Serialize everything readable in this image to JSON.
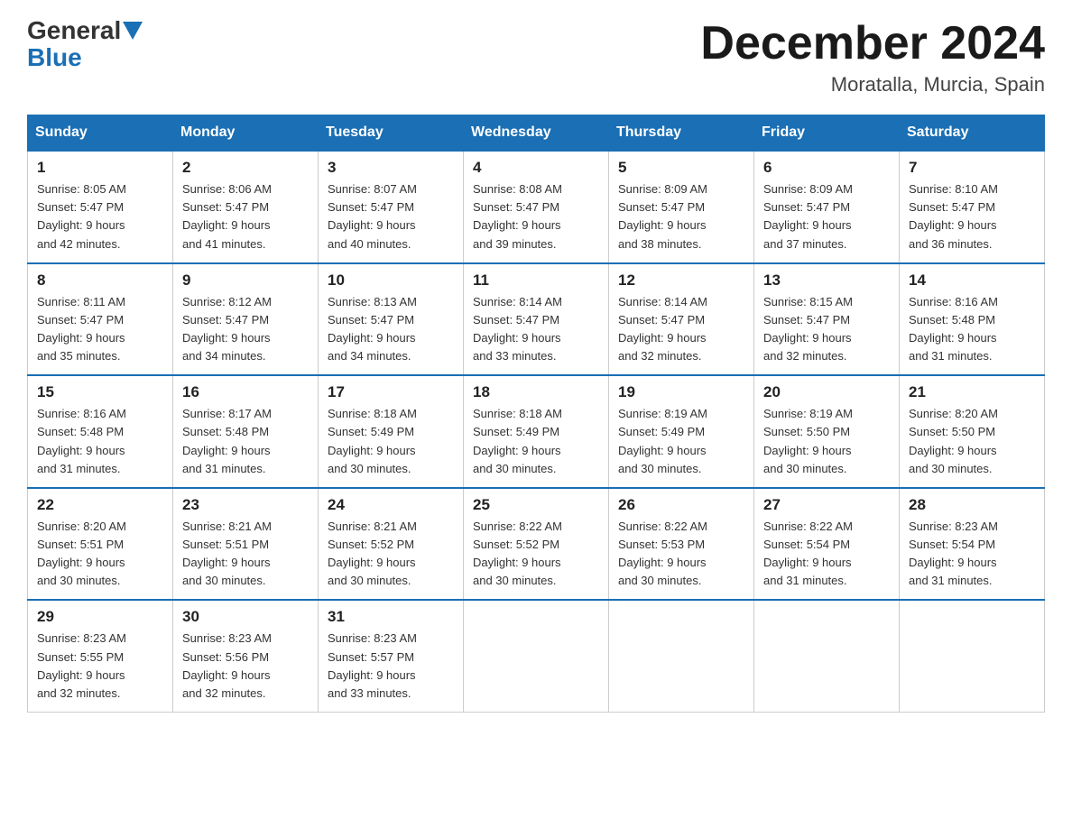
{
  "header": {
    "logo_general": "General",
    "logo_blue": "Blue",
    "month_year": "December 2024",
    "location": "Moratalla, Murcia, Spain"
  },
  "weekdays": [
    "Sunday",
    "Monday",
    "Tuesday",
    "Wednesday",
    "Thursday",
    "Friday",
    "Saturday"
  ],
  "weeks": [
    [
      {
        "day": "1",
        "sunrise": "8:05 AM",
        "sunset": "5:47 PM",
        "daylight": "9 hours and 42 minutes."
      },
      {
        "day": "2",
        "sunrise": "8:06 AM",
        "sunset": "5:47 PM",
        "daylight": "9 hours and 41 minutes."
      },
      {
        "day": "3",
        "sunrise": "8:07 AM",
        "sunset": "5:47 PM",
        "daylight": "9 hours and 40 minutes."
      },
      {
        "day": "4",
        "sunrise": "8:08 AM",
        "sunset": "5:47 PM",
        "daylight": "9 hours and 39 minutes."
      },
      {
        "day": "5",
        "sunrise": "8:09 AM",
        "sunset": "5:47 PM",
        "daylight": "9 hours and 38 minutes."
      },
      {
        "day": "6",
        "sunrise": "8:09 AM",
        "sunset": "5:47 PM",
        "daylight": "9 hours and 37 minutes."
      },
      {
        "day": "7",
        "sunrise": "8:10 AM",
        "sunset": "5:47 PM",
        "daylight": "9 hours and 36 minutes."
      }
    ],
    [
      {
        "day": "8",
        "sunrise": "8:11 AM",
        "sunset": "5:47 PM",
        "daylight": "9 hours and 35 minutes."
      },
      {
        "day": "9",
        "sunrise": "8:12 AM",
        "sunset": "5:47 PM",
        "daylight": "9 hours and 34 minutes."
      },
      {
        "day": "10",
        "sunrise": "8:13 AM",
        "sunset": "5:47 PM",
        "daylight": "9 hours and 34 minutes."
      },
      {
        "day": "11",
        "sunrise": "8:14 AM",
        "sunset": "5:47 PM",
        "daylight": "9 hours and 33 minutes."
      },
      {
        "day": "12",
        "sunrise": "8:14 AM",
        "sunset": "5:47 PM",
        "daylight": "9 hours and 32 minutes."
      },
      {
        "day": "13",
        "sunrise": "8:15 AM",
        "sunset": "5:47 PM",
        "daylight": "9 hours and 32 minutes."
      },
      {
        "day": "14",
        "sunrise": "8:16 AM",
        "sunset": "5:48 PM",
        "daylight": "9 hours and 31 minutes."
      }
    ],
    [
      {
        "day": "15",
        "sunrise": "8:16 AM",
        "sunset": "5:48 PM",
        "daylight": "9 hours and 31 minutes."
      },
      {
        "day": "16",
        "sunrise": "8:17 AM",
        "sunset": "5:48 PM",
        "daylight": "9 hours and 31 minutes."
      },
      {
        "day": "17",
        "sunrise": "8:18 AM",
        "sunset": "5:49 PM",
        "daylight": "9 hours and 30 minutes."
      },
      {
        "day": "18",
        "sunrise": "8:18 AM",
        "sunset": "5:49 PM",
        "daylight": "9 hours and 30 minutes."
      },
      {
        "day": "19",
        "sunrise": "8:19 AM",
        "sunset": "5:49 PM",
        "daylight": "9 hours and 30 minutes."
      },
      {
        "day": "20",
        "sunrise": "8:19 AM",
        "sunset": "5:50 PM",
        "daylight": "9 hours and 30 minutes."
      },
      {
        "day": "21",
        "sunrise": "8:20 AM",
        "sunset": "5:50 PM",
        "daylight": "9 hours and 30 minutes."
      }
    ],
    [
      {
        "day": "22",
        "sunrise": "8:20 AM",
        "sunset": "5:51 PM",
        "daylight": "9 hours and 30 minutes."
      },
      {
        "day": "23",
        "sunrise": "8:21 AM",
        "sunset": "5:51 PM",
        "daylight": "9 hours and 30 minutes."
      },
      {
        "day": "24",
        "sunrise": "8:21 AM",
        "sunset": "5:52 PM",
        "daylight": "9 hours and 30 minutes."
      },
      {
        "day": "25",
        "sunrise": "8:22 AM",
        "sunset": "5:52 PM",
        "daylight": "9 hours and 30 minutes."
      },
      {
        "day": "26",
        "sunrise": "8:22 AM",
        "sunset": "5:53 PM",
        "daylight": "9 hours and 30 minutes."
      },
      {
        "day": "27",
        "sunrise": "8:22 AM",
        "sunset": "5:54 PM",
        "daylight": "9 hours and 31 minutes."
      },
      {
        "day": "28",
        "sunrise": "8:23 AM",
        "sunset": "5:54 PM",
        "daylight": "9 hours and 31 minutes."
      }
    ],
    [
      {
        "day": "29",
        "sunrise": "8:23 AM",
        "sunset": "5:55 PM",
        "daylight": "9 hours and 32 minutes."
      },
      {
        "day": "30",
        "sunrise": "8:23 AM",
        "sunset": "5:56 PM",
        "daylight": "9 hours and 32 minutes."
      },
      {
        "day": "31",
        "sunrise": "8:23 AM",
        "sunset": "5:57 PM",
        "daylight": "9 hours and 33 minutes."
      },
      null,
      null,
      null,
      null
    ]
  ],
  "labels": {
    "sunrise": "Sunrise:",
    "sunset": "Sunset:",
    "daylight": "Daylight:"
  }
}
